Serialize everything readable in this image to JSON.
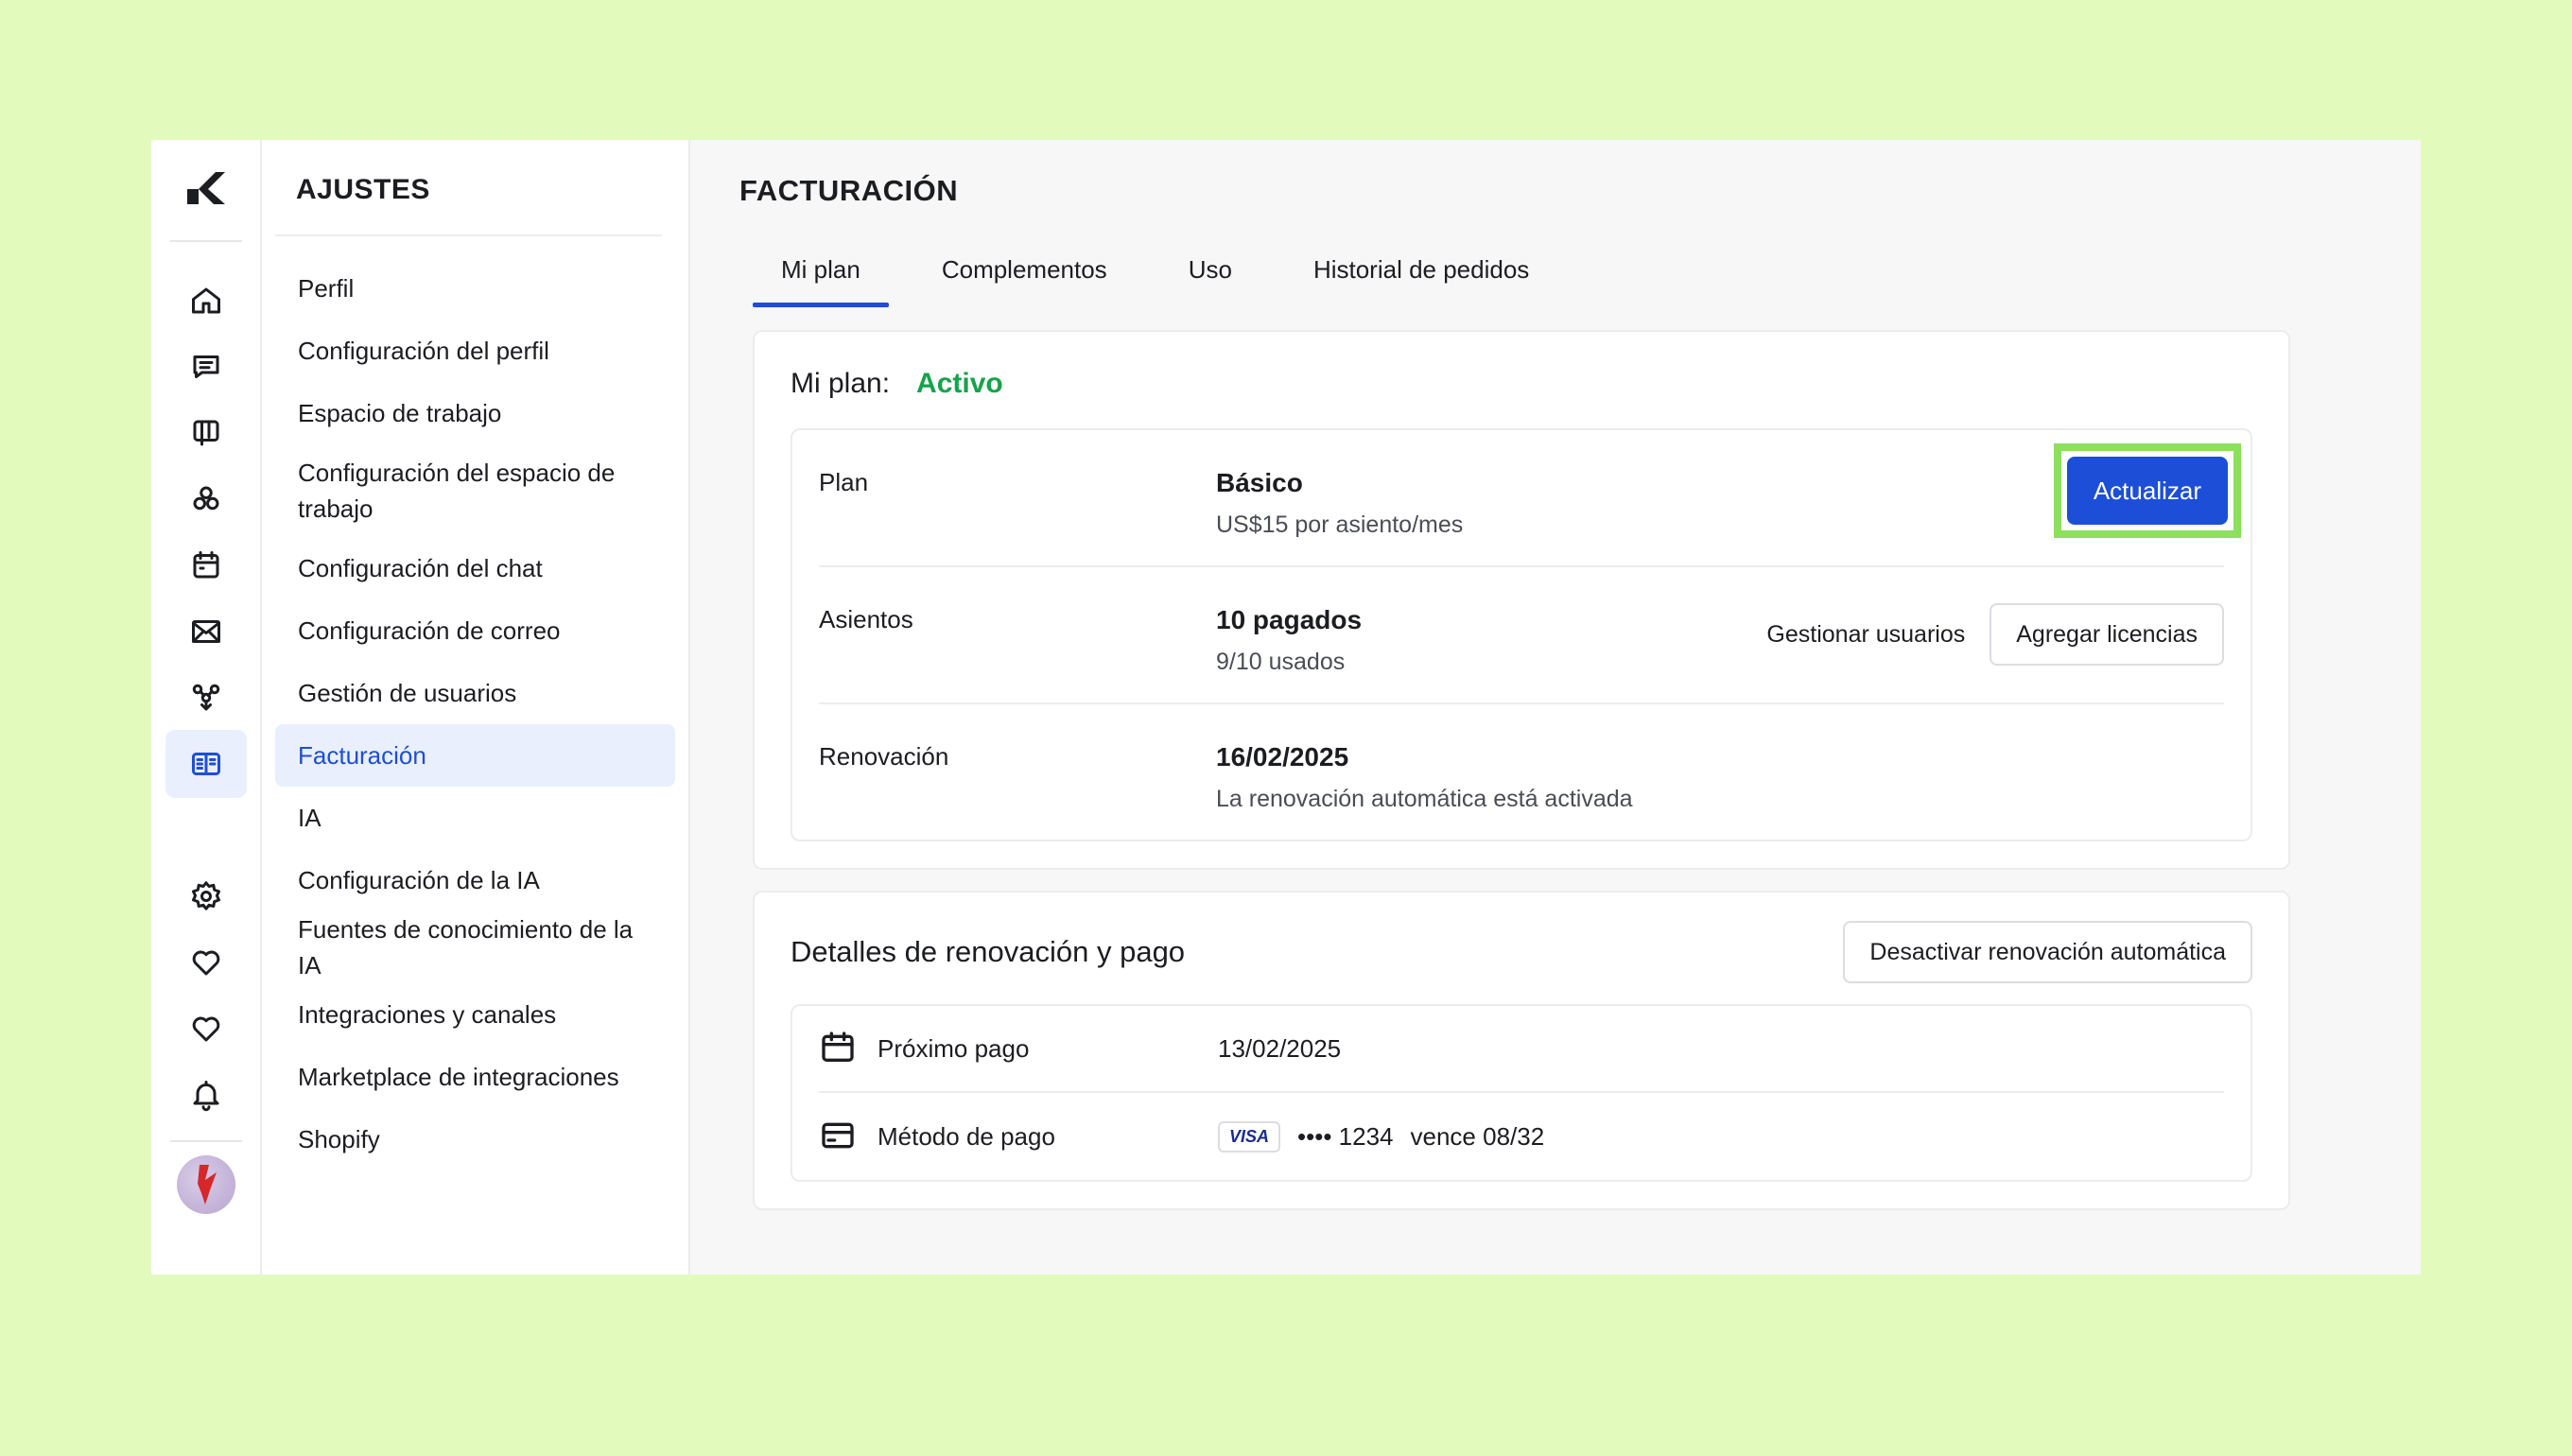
{
  "colors": {
    "accent": "#1d4ed8",
    "active_status": "#16a34a",
    "highlight": "#8be05c",
    "background": "#e2fbbd"
  },
  "rail": {
    "icons": [
      "home-icon",
      "chat-icon",
      "board-icon",
      "contacts-icon",
      "calendar-icon",
      "mail-icon",
      "workflow-icon",
      "billing-icon",
      "settings-icon",
      "heart-icon",
      "heart-icon",
      "bell-icon"
    ]
  },
  "menu": {
    "title": "AJUSTES",
    "items": [
      {
        "label": "Perfil"
      },
      {
        "label": "Configuración del perfil"
      },
      {
        "label": "Espacio de trabajo"
      },
      {
        "label": "Configuración del espacio de trabajo"
      },
      {
        "label": "Configuración del chat"
      },
      {
        "label": "Configuración de correo"
      },
      {
        "label": "Gestión de usuarios"
      },
      {
        "label": "Facturación",
        "active": true
      },
      {
        "label": "IA"
      },
      {
        "label": "Configuración de la IA"
      },
      {
        "label": "Fuentes de conocimiento de la IA"
      },
      {
        "label": "Integraciones y canales"
      },
      {
        "label": "Marketplace de integraciones"
      },
      {
        "label": "Shopify"
      }
    ]
  },
  "main": {
    "title": "FACTURACIÓN",
    "tabs": [
      {
        "label": "Mi plan",
        "active": true
      },
      {
        "label": "Complementos"
      },
      {
        "label": "Uso"
      },
      {
        "label": "Historial de pedidos"
      }
    ],
    "plan_card": {
      "label": "Mi plan:",
      "status": "Activo",
      "rows": {
        "plan": {
          "label": "Plan",
          "value": "Básico",
          "sub": "US$15 por asiento/mes",
          "action": "Actualizar"
        },
        "seats": {
          "label": "Asientos",
          "value": "10 pagados",
          "sub": "9/10 usados",
          "action_text": "Gestionar usuarios",
          "action_button": "Agregar licencias"
        },
        "renewal": {
          "label": "Renovación",
          "value": "16/02/2025",
          "sub": "La renovación automática está activada"
        }
      }
    },
    "payment_card": {
      "title": "Detalles de renovación y pago",
      "button": "Desactivar renovación automática",
      "next_payment": {
        "label": "Próximo pago",
        "value": "13/02/2025"
      },
      "payment_method": {
        "label": "Método de pago",
        "brand": "VISA",
        "masked": "•••• 1234",
        "expiry": "vence 08/32"
      }
    }
  }
}
